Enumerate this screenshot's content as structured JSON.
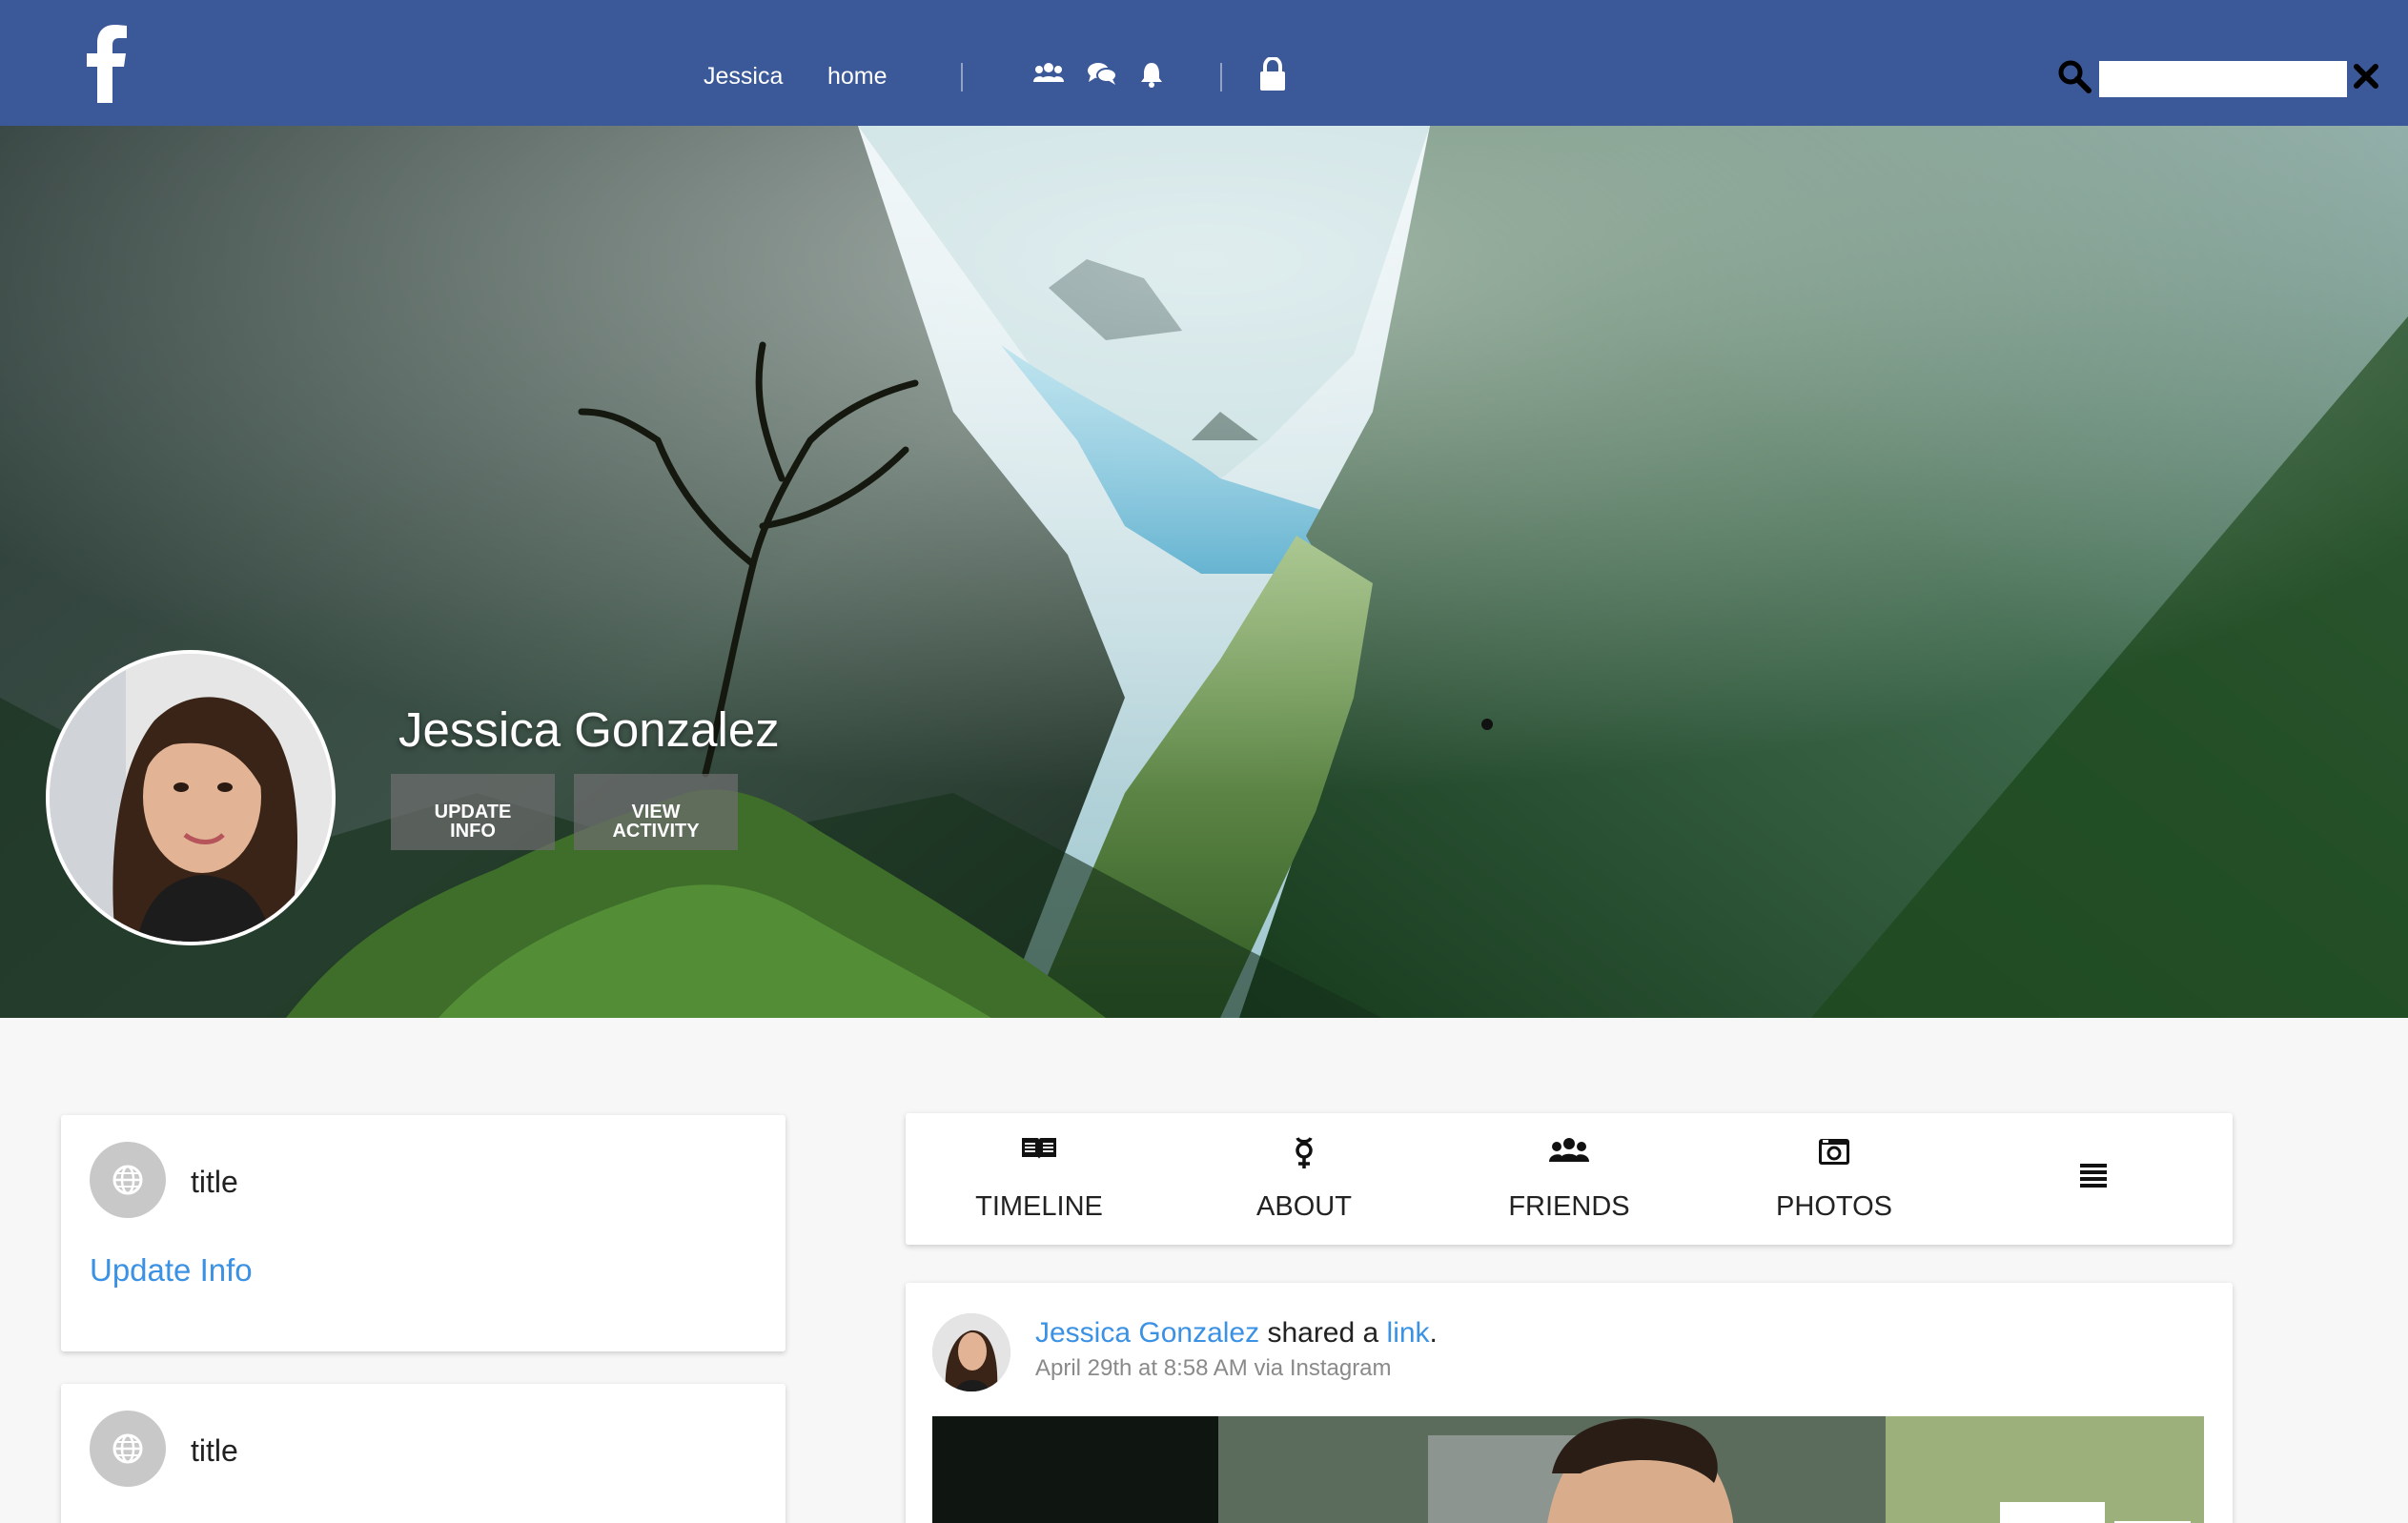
{
  "nav": {
    "user_link": "Jessica",
    "home_link": "home",
    "icons": [
      "friends-icon",
      "chat-icon",
      "bell-icon",
      "lock-icon"
    ],
    "search_placeholder": "",
    "brand_color": "#3b5898"
  },
  "profile": {
    "name": "Jessica Gonzalez",
    "update_button": "UPDATE\nINFO",
    "activity_button": "VIEW\nACTIVITY"
  },
  "info_cards": [
    {
      "title": "title",
      "link": "Update Info"
    },
    {
      "title": "title"
    }
  ],
  "tabs": [
    {
      "label": "TIMELINE",
      "icon": "book-icon"
    },
    {
      "label": "ABOUT",
      "icon": "gender-icon"
    },
    {
      "label": "FRIENDS",
      "icon": "friends-icon"
    },
    {
      "label": "PHOTOS",
      "icon": "camera-icon"
    }
  ],
  "post": {
    "author": "Jessica Gonzalez",
    "action": " shared a ",
    "link": "link",
    "period": ".",
    "meta": "April 29th at 8:58 AM via Instagram"
  },
  "colors": {
    "link": "#3b91e3",
    "background": "#f7f7f7"
  }
}
